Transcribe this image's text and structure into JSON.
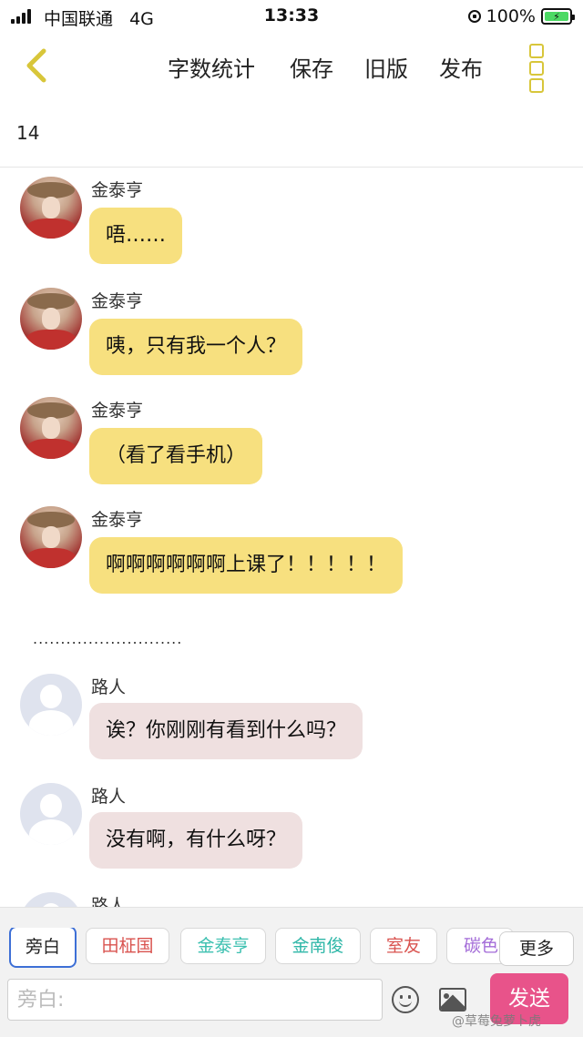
{
  "status_bar": {
    "carrier": "中国联通",
    "network": "4G",
    "time": "13:33",
    "battery": "100%"
  },
  "toolbar": {
    "items": [
      "字数统计",
      "保存",
      "旧版",
      "发布"
    ]
  },
  "word_count": "14",
  "messages": [
    {
      "sender": "金泰亨",
      "text": "唔……",
      "avatar": "kim"
    },
    {
      "sender": "金泰亨",
      "text": "咦，只有我一个人？",
      "avatar": "kim"
    },
    {
      "sender": "金泰亨",
      "text": "（看了看手机）",
      "avatar": "kim"
    },
    {
      "sender": "金泰亨",
      "text": "啊啊啊啊啊啊上课了！！！！！",
      "avatar": "kim"
    },
    {
      "sender": "路人",
      "text": "诶？你刚刚有看到什么吗？",
      "avatar": "passerby"
    },
    {
      "sender": "路人",
      "text": "没有啊，有什么呀？",
      "avatar": "passerby"
    },
    {
      "sender": "路人",
      "text": "",
      "avatar": "passerby"
    }
  ],
  "separator": "...........................",
  "roles": {
    "tabs": [
      {
        "label": "旁白",
        "color": "#222222"
      },
      {
        "label": "田柾国",
        "color": "#d9534f"
      },
      {
        "label": "金泰亨",
        "color": "#3cc0b0"
      },
      {
        "label": "金南俊",
        "color": "#2fb7a8"
      },
      {
        "label": "室友",
        "color": "#d9534f"
      },
      {
        "label": "碳色",
        "color": "#a36bd8"
      }
    ],
    "more": "更多"
  },
  "composer": {
    "placeholder": "旁白:",
    "send": "发送"
  },
  "watermark": "@草莓兔萝卜虎",
  "colors": {
    "yellow_bubble": "#f7e07f",
    "pink_bubble": "#efe0e0",
    "send_button": "#e8538a",
    "active_tab_border": "#3d6fd6"
  }
}
